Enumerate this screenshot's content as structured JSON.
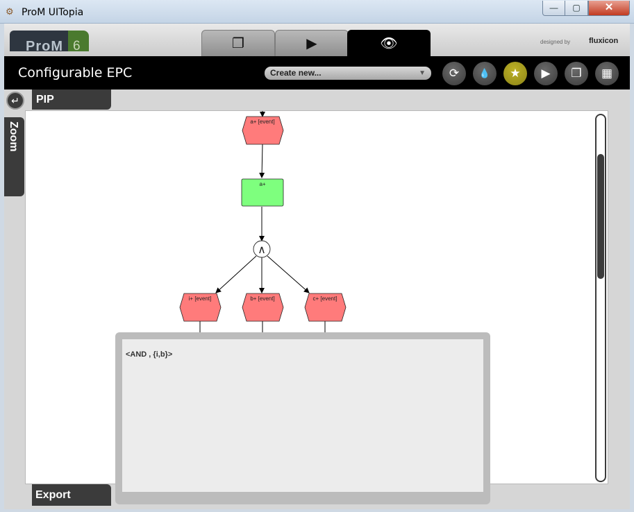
{
  "window": {
    "title": "ProM UITopia",
    "min": "—",
    "max": "▢",
    "close": "✕"
  },
  "logo": {
    "text": "ProM",
    "version": "6"
  },
  "tabs": [
    {
      "name": "workspace",
      "icon": "documents-icon",
      "glyph": "❐"
    },
    {
      "name": "actions",
      "icon": "play-icon",
      "glyph": "▶"
    },
    {
      "name": "views",
      "icon": "eye-icon",
      "glyph": "👁"
    }
  ],
  "branding": {
    "designed_by": "designed by",
    "company": "fluxicon"
  },
  "header": {
    "title": "Configurable EPC",
    "create_label": "Create new...",
    "buttons": [
      {
        "name": "refresh",
        "glyph": "⟳"
      },
      {
        "name": "drop",
        "glyph": "💧"
      },
      {
        "name": "favorite",
        "glyph": "★"
      },
      {
        "name": "play",
        "glyph": "▶"
      },
      {
        "name": "copy",
        "glyph": "❐"
      },
      {
        "name": "grid",
        "glyph": "▦"
      }
    ]
  },
  "panels": {
    "pip": "PIP",
    "zoom": "Zoom",
    "export": "Export"
  },
  "graph": {
    "nodes": [
      {
        "id": "ev-a",
        "type": "event",
        "label": "a+ [event]"
      },
      {
        "id": "fn-a",
        "type": "function",
        "label": "a+"
      },
      {
        "id": "and",
        "type": "connector",
        "label": "∧"
      },
      {
        "id": "ev-i",
        "type": "event",
        "label": "i+ [event]"
      },
      {
        "id": "ev-b",
        "type": "event",
        "label": "b+ [event]"
      },
      {
        "id": "ev-c",
        "type": "event",
        "label": "c+ [event]"
      }
    ],
    "colors": {
      "event": "#ff7b7b",
      "function": "#7eff7e"
    }
  },
  "popup": {
    "text": "<AND , {i,b}>"
  }
}
